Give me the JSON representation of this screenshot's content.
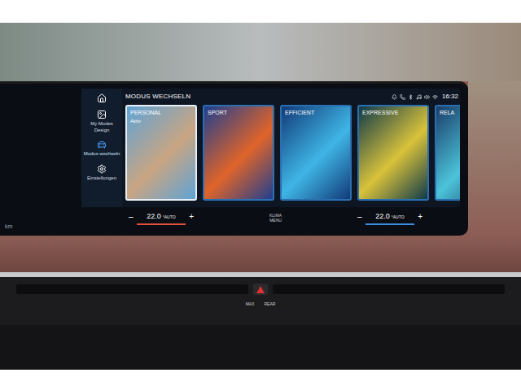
{
  "screen": {
    "left_unit": "km",
    "header": "MODUS WECHSELN",
    "time": "16:32"
  },
  "sidebar": {
    "items": [
      {
        "label": "My Modes Design",
        "selected": false,
        "kind": "image"
      },
      {
        "label": "Modus wechseln",
        "selected": true,
        "kind": "modes"
      },
      {
        "label": "Einstellungen",
        "selected": false,
        "kind": "settings"
      }
    ]
  },
  "cards": [
    {
      "label": "PERSONAL",
      "status": "Aktiv",
      "selected": true,
      "color": "#c9a582",
      "color2": "#5fa3d6"
    },
    {
      "label": "SPORT",
      "status": "",
      "selected": false,
      "color": "#e0642a",
      "color2": "#1f3f8f"
    },
    {
      "label": "EFFICIENT",
      "status": "",
      "selected": false,
      "color": "#3fb6e6",
      "color2": "#123a78"
    },
    {
      "label": "EXPRESSIVE",
      "status": "",
      "selected": false,
      "color": "#d9c23a",
      "color2": "#0f3a4a"
    },
    {
      "label": "RELA",
      "status": "",
      "selected": false,
      "color": "#4cc3d9",
      "color2": "#1a3d6a"
    }
  ],
  "climate": {
    "left": {
      "minus": "–",
      "value": "22.0",
      "unit": "°AUTO",
      "plus": "+",
      "color": "#e0503a"
    },
    "center": "KLIMA MENU",
    "right": {
      "minus": "–",
      "value": "22.0",
      "unit": "°AUTO",
      "plus": "+",
      "color": "#3a8fe0"
    }
  },
  "dashboard": {
    "buttons": [
      "MAX",
      "REAR"
    ]
  }
}
